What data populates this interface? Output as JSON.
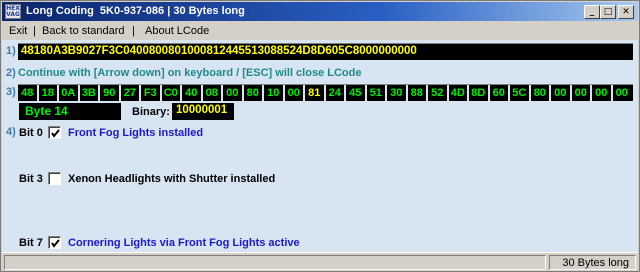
{
  "window": {
    "title": "Long Coding  5K0-937-086 | 30 Bytes long",
    "icon_text": "HEX VAG",
    "controls": {
      "minimize": "_",
      "maximize": "□",
      "close": "✕"
    }
  },
  "menu": {
    "items": [
      "Exit",
      "Back to standard",
      "About LCode"
    ],
    "separator": "|"
  },
  "steps": [
    "1)",
    "2)",
    "3)",
    "4)"
  ],
  "coding": "48180A3B9027F3C0400800801000812445513088524D8D605C8000000000",
  "instruction": "Continue with [Arrow down] on keyboard / [ESC] will close LCode",
  "bytes": [
    "48",
    "18",
    "0A",
    "3B",
    "90",
    "27",
    "F3",
    "C0",
    "40",
    "08",
    "00",
    "80",
    "10",
    "00",
    "81",
    "24",
    "45",
    "51",
    "30",
    "88",
    "52",
    "4D",
    "8D",
    "60",
    "5C",
    "80",
    "00",
    "00",
    "00",
    "00"
  ],
  "selected_byte_index": 14,
  "byte_label": "Byte 14",
  "binary_caption": "Binary:",
  "binary_value": "10000001",
  "bits": [
    {
      "label": "Bit 0",
      "checked": true,
      "text": "Front Fog Lights installed",
      "color": "#1a1acd"
    },
    {
      "label": "Bit 3",
      "checked": false,
      "text": "Xenon Headlights with Shutter installed",
      "color": "#000000"
    },
    {
      "label": "Bit 7",
      "checked": true,
      "text": "Cornering Lights via Front Fog Lights active",
      "color": "#1a1acd"
    }
  ],
  "status": {
    "left": "",
    "right": "30 Bytes long"
  },
  "colors": {
    "client_bg": "#d7e4f2",
    "chrome_bg": "#d4d0c8",
    "coding_text": "#ffff00",
    "byte_text": "#00ee00",
    "selected_byte_text": "#ffff00",
    "instruction_text": "#1e8a8a",
    "step_number": "#4a7aa8"
  }
}
